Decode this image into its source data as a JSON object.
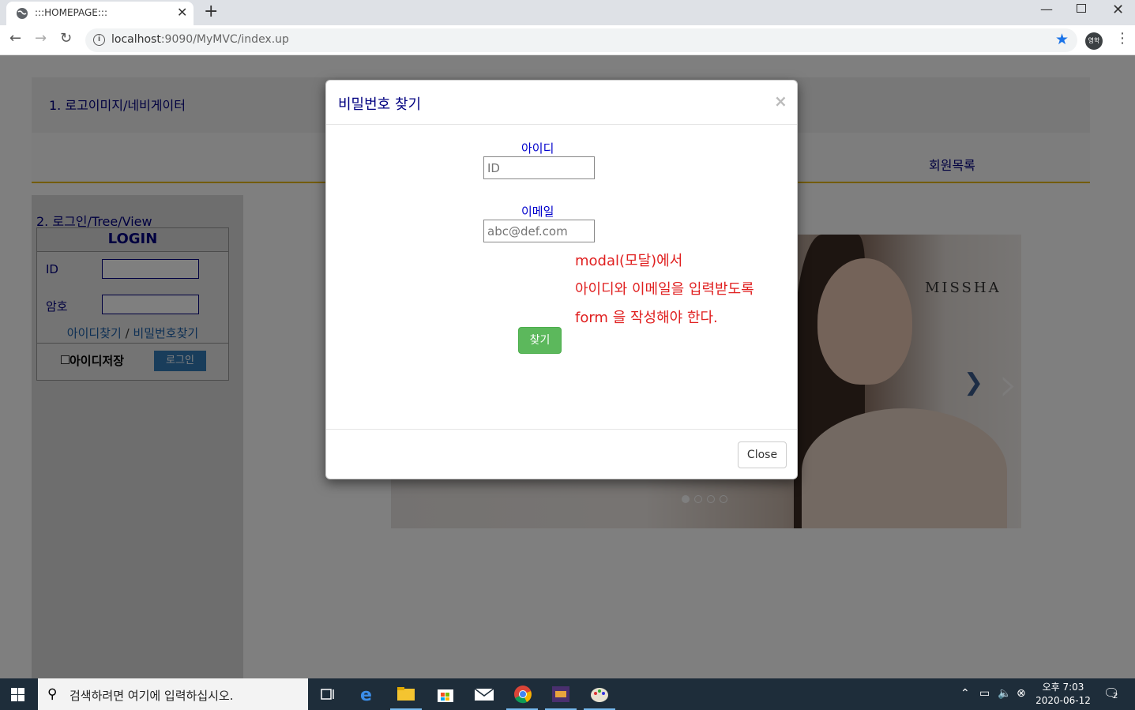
{
  "browser": {
    "tab_title": ":::HOMEPAGE:::",
    "new_tab_label": "+",
    "url_host": "localhost",
    "url_rest": ":9090/MyMVC/index.up",
    "profile_label": "영학"
  },
  "page": {
    "header_text": "1. 로고이미지/네비게이터",
    "nav_members": "회원목록",
    "left_title": "2. 로그인/Tree/View",
    "login": {
      "title": "LOGIN",
      "id_label": "ID",
      "pw_label": "암호",
      "find_id": "아이디찾기",
      "separator": "/",
      "find_pw": "비밀번호찾기",
      "save_id": "아이디저장",
      "login_button": "로그인"
    },
    "carousel": {
      "brand": "MISSHA",
      "next_icon": "chevron-right-icon",
      "slide_count": 4,
      "active_slide": 1
    }
  },
  "modal": {
    "title": "비밀번호 찾기",
    "close_x": "×",
    "id_label": "아이디",
    "id_placeholder": "ID",
    "email_label": "이메일",
    "email_placeholder": "abc@def.com",
    "note_lines": [
      "modal(모달)에서",
      "아이디와 이메일을 입력받도록",
      "form 을 작성해야 한다."
    ],
    "find_button": "찾기",
    "close_button": "Close"
  },
  "taskbar": {
    "search_placeholder": "검색하려면 여기에 입력하십시오.",
    "time": "오후 7:03",
    "date": "2020-06-12",
    "notification_count": "2"
  },
  "colors": {
    "accent_navy": "#000080",
    "note_red": "#e02020",
    "find_green": "#5cb85c",
    "nav_border": "#e6b800"
  }
}
